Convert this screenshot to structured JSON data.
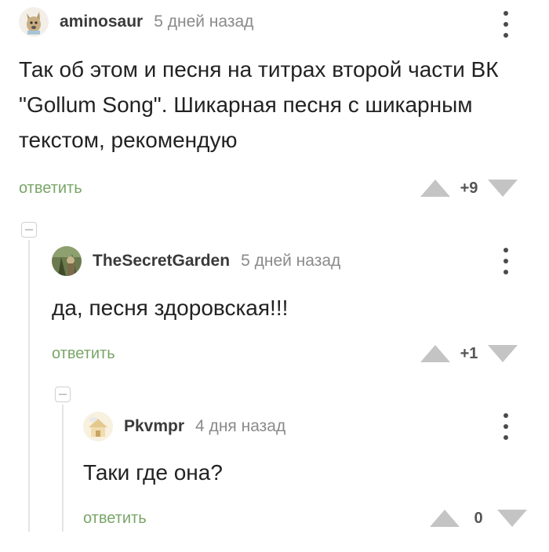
{
  "comments": [
    {
      "username": "aminosaur",
      "time": "5 дней назад",
      "text": "Так об этом и песня на титрах второй части ВК \"Gollum Song\". Шикарная песня с шикарным текстом, рекомендую",
      "reply_label": "ответить",
      "score": "+9"
    },
    {
      "username": "TheSecretGarden",
      "time": "5 дней назад",
      "text": "да,  песня здоровская!!!",
      "reply_label": "ответить",
      "score": "+1"
    },
    {
      "username": "Pkvmpr",
      "time": "4 дня назад",
      "text": "Таки где она?",
      "reply_label": "ответить",
      "score": "0"
    }
  ],
  "icons": {
    "menu": "kebab-menu-icon",
    "upvote": "triangle-up-icon",
    "downvote": "triangle-down-icon",
    "collapse": "collapse-thread-icon"
  },
  "colors": {
    "accent_green": "#7aa568",
    "vote_arrow": "#c4c4c4",
    "menu_dots": "#4a4a4a"
  }
}
